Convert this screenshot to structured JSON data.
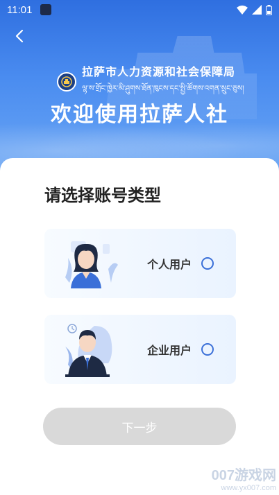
{
  "status_bar": {
    "time": "11:01"
  },
  "header": {
    "org_name_cn": "拉萨市人力资源和社会保障局",
    "org_name_tibetan": "ལྷ་ས་གྲོང་ཁྱེར་མི་ཤུགས་ཐོན་ཁུངས་དང་སྤྱི་ཚོགས་འགན་སྲུང་ཅུས།",
    "welcome_title": "欢迎使用拉萨人社"
  },
  "main": {
    "heading": "请选择账号类型",
    "options": [
      {
        "label": "个人用户",
        "selected": false
      },
      {
        "label": "企业用户",
        "selected": false
      }
    ],
    "next_button_label": "下一步"
  },
  "watermark": {
    "line1": "007游戏网",
    "line2": "www.yx007.com"
  },
  "colors": {
    "accent": "#3a6fd8",
    "hero_top": "#2f6fe0",
    "button_disabled": "#d9d9d9"
  },
  "icons": [
    "back-chevron-icon",
    "wifi-icon",
    "signal-icon",
    "battery-icon",
    "emblem-icon",
    "radio-icon"
  ]
}
